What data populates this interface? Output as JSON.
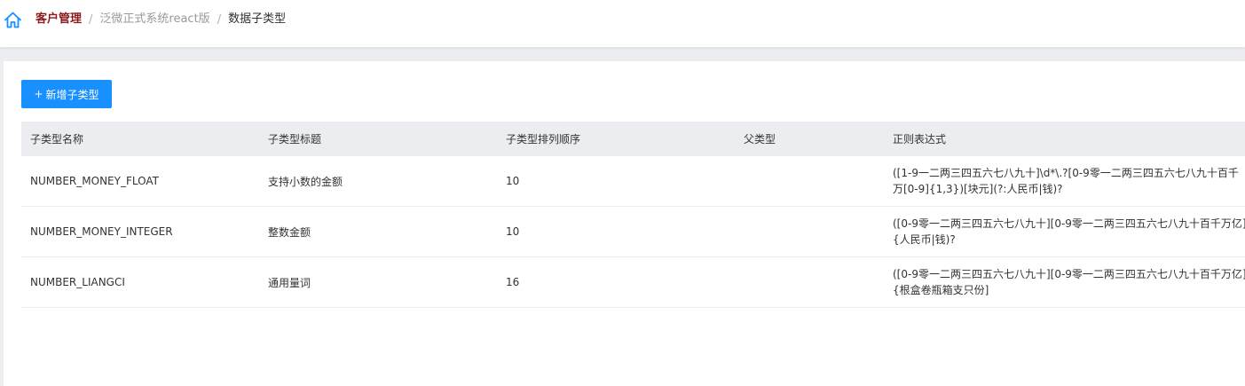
{
  "breadcrumb": {
    "items": [
      "客户管理",
      "泛微正式系统react版",
      "数据子类型"
    ],
    "separator": "/"
  },
  "toolbar": {
    "add_icon": "+",
    "add_label": "新增子类型"
  },
  "table": {
    "headers": [
      "子类型名称",
      "子类型标题",
      "子类型排列顺序",
      "父类型",
      "正则表达式"
    ],
    "rows": [
      {
        "name": "NUMBER_MONEY_FLOAT",
        "title": "支持小数的金额",
        "order": "10",
        "parent": "",
        "regex": "([1-9一二两三四五六七八九十]\\d*\\.?[0-9零一二两三四五六七八九十百千万[0-9]{1,3})[块元](?:人民币|钱)?"
      },
      {
        "name": "NUMBER_MONEY_INTEGER",
        "title": "整数金额",
        "order": "10",
        "parent": "",
        "regex": "([0-9零一二两三四五六七八九十][0-9零一二两三四五六七八九十百千万亿]{人民币|钱)?"
      },
      {
        "name": "NUMBER_LIANGCI",
        "title": "通用量词",
        "order": "16",
        "parent": "",
        "regex": "([0-9零一二两三四五六七八九十][0-9零一二两三四五六七八九十百千万亿]{根盒卷瓶箱支只份]"
      }
    ]
  },
  "colors": {
    "accent": "#1890ff",
    "breadcrumb_active": "#8b1a1a",
    "header_bg": "#ebedf0"
  }
}
